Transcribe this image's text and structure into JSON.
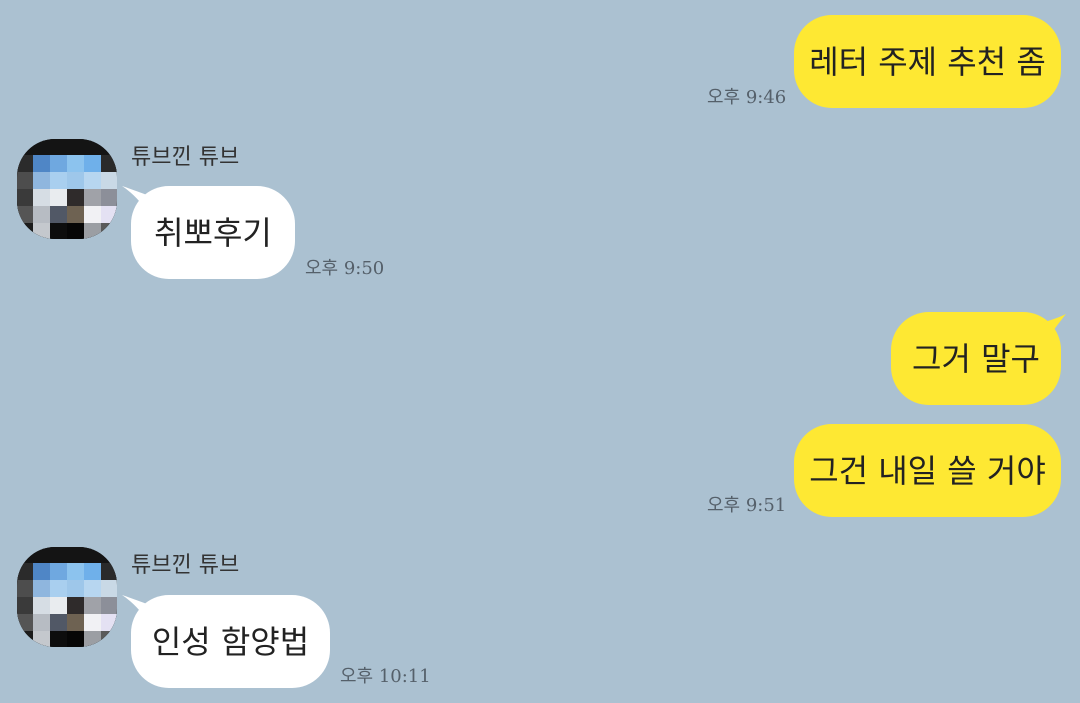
{
  "chat": {
    "background_color": "#abc1d1",
    "my_bubble_color": "#fee833",
    "their_bubble_color": "#ffffff",
    "messages": [
      {
        "sender": "me",
        "text": "레터 주제 추천 좀",
        "time": "오후 9:46"
      },
      {
        "sender": "튜브낀 튜브",
        "text": "취뽀후기",
        "time": "오후 9:50"
      },
      {
        "sender": "me",
        "text": "그거 말구",
        "time": ""
      },
      {
        "sender": "me",
        "text": "그건 내일 쓸 거야",
        "time": "오후 9:51"
      },
      {
        "sender": "튜브낀 튜브",
        "text": "인성 함양법",
        "time": "오후 10:11"
      }
    ],
    "groups": [
      {
        "sender_name": "튜브낀 튜브",
        "avatar_icon": "pixelated-profile-icon"
      },
      {
        "sender_name": "튜브낀 튜브",
        "avatar_icon": "pixelated-profile-icon"
      }
    ]
  }
}
